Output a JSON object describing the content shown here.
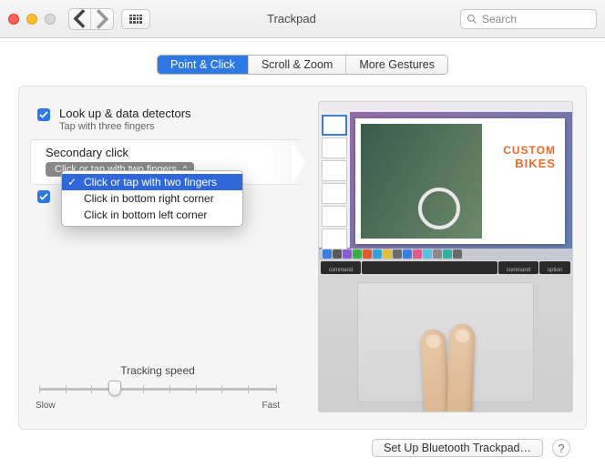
{
  "window": {
    "title": "Trackpad"
  },
  "search": {
    "placeholder": "Search"
  },
  "tabs": {
    "point_click": "Point & Click",
    "scroll_zoom": "Scroll & Zoom",
    "more_gestures": "More Gestures"
  },
  "options": {
    "lookup": {
      "title": "Look up & data detectors",
      "sub": "Tap with three fingers"
    },
    "secondary": {
      "title": "Secondary click",
      "selected": "Click or tap with two fingers"
    },
    "dropdown": {
      "item0": "Click or tap with two fingers",
      "item1": "Click in bottom right corner",
      "item2": "Click in bottom left corner"
    }
  },
  "tracking": {
    "label": "Tracking speed",
    "slow": "Slow",
    "fast": "Fast"
  },
  "preview": {
    "doc_line1": "CUSTOM",
    "doc_line2": "BIKES",
    "key_cmd": "command",
    "key_opt": "option"
  },
  "footer": {
    "bluetooth": "Set Up Bluetooth Trackpad…",
    "help": "?"
  }
}
